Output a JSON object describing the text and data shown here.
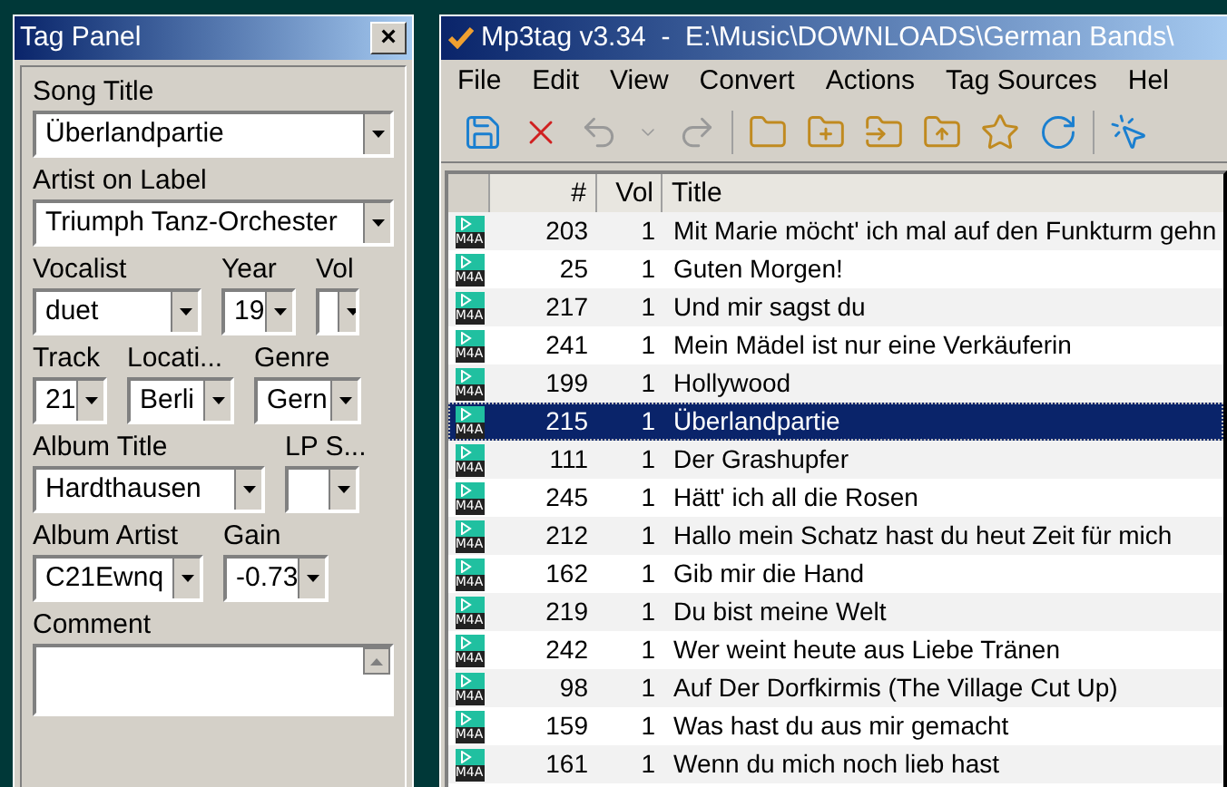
{
  "tag_panel": {
    "title": "Tag Panel",
    "close": "×",
    "fields": [
      {
        "kind": "row",
        "items": [
          {
            "label": "Song Title",
            "value": "Überlandpartie"
          }
        ]
      },
      {
        "kind": "row",
        "items": [
          {
            "label": "Artist on Label",
            "value": "Triumph Tanz-Orchester"
          }
        ]
      },
      {
        "kind": "row",
        "items": [
          {
            "label": "Vocalist",
            "value": "duet"
          },
          {
            "label": "Year",
            "value": "19"
          },
          {
            "label": "Vol"
          }
        ]
      },
      {
        "kind": "row",
        "items": [
          {
            "label": "Track",
            "value": "21"
          },
          {
            "label": "Locati...",
            "value": "Berli"
          },
          {
            "label": "Genre",
            "value": "Gern"
          }
        ]
      },
      {
        "kind": "row",
        "items": [
          {
            "label": "Album Title",
            "value": "Hardthausen"
          },
          {
            "label": "LP S..."
          }
        ]
      },
      {
        "kind": "row",
        "items": [
          {
            "label": "Album Artist",
            "value": "C21Ewnq"
          },
          {
            "label": "Gain",
            "value": "-0.73"
          }
        ]
      },
      {
        "kind": "memo",
        "items": [
          {
            "label": "Comment"
          }
        ]
      }
    ]
  },
  "main": {
    "title": "Mp3tag v3.34  -  E:\\Music\\DOWNLOADS\\German Bands\\",
    "menu": [
      "File",
      "Edit",
      "View",
      "Convert",
      "Actions",
      "Tag Sources",
      "Hel"
    ],
    "table": {
      "columns": [
        "#",
        "Vol",
        "Title"
      ],
      "rows": [
        {
          "type": "M4A",
          "number": "203",
          "vol": "1",
          "title": "Mit Marie möcht' ich mal auf den Funkturm gehn",
          "selected": false
        },
        {
          "type": "M4A",
          "number": "25",
          "vol": "1",
          "title": "Guten Morgen!",
          "selected": false
        },
        {
          "type": "M4A",
          "number": "217",
          "vol": "1",
          "title": "Und mir sagst du",
          "selected": false
        },
        {
          "type": "M4A",
          "number": "241",
          "vol": "1",
          "title": "Mein Mädel ist nur eine Verkäuferin",
          "selected": false
        },
        {
          "type": "M4A",
          "number": "199",
          "vol": "1",
          "title": "Hollywood",
          "selected": false
        },
        {
          "type": "M4A",
          "number": "215",
          "vol": "1",
          "title": "Überlandpartie",
          "selected": true
        },
        {
          "type": "M4A",
          "number": "111",
          "vol": "1",
          "title": "Der Grashupfer",
          "selected": false
        },
        {
          "type": "M4A",
          "number": "245",
          "vol": "1",
          "title": "Hätt' ich all die Rosen",
          "selected": false
        },
        {
          "type": "M4A",
          "number": "212",
          "vol": "1",
          "title": "Hallo mein Schatz hast du heut Zeit für mich",
          "selected": false
        },
        {
          "type": "M4A",
          "number": "162",
          "vol": "1",
          "title": "Gib mir die Hand",
          "selected": false
        },
        {
          "type": "M4A",
          "number": "219",
          "vol": "1",
          "title": "Du bist meine Welt",
          "selected": false
        },
        {
          "type": "M4A",
          "number": "242",
          "vol": "1",
          "title": "Wer weint heute aus Liebe Tränen",
          "selected": false
        },
        {
          "type": "M4A",
          "number": "98",
          "vol": "1",
          "title": "Auf Der Dorfkirmis (The Village Cut Up)",
          "selected": false
        },
        {
          "type": "M4A",
          "number": "159",
          "vol": "1",
          "title": "Was hast du aus mir gemacht",
          "selected": false
        },
        {
          "type": "M4A",
          "number": "161",
          "vol": "1",
          "title": "Wenn du mich noch lieb hast",
          "selected": false
        }
      ]
    }
  }
}
